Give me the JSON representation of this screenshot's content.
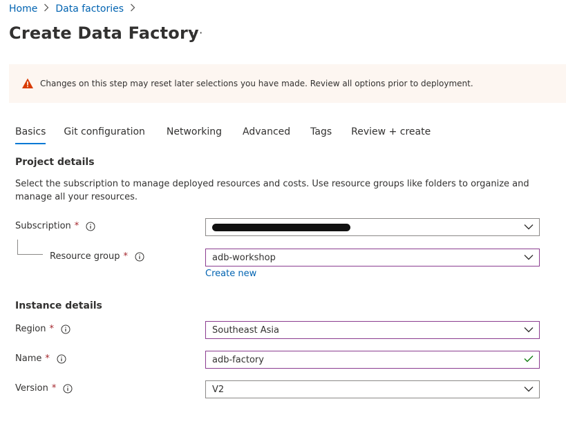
{
  "breadcrumb": [
    {
      "label": "Home"
    },
    {
      "label": "Data factories"
    }
  ],
  "page": {
    "title": "Create Data Factory",
    "more": "···"
  },
  "warning": {
    "text": "Changes on this step may reset later selections you have made. Review all options prior to deployment.",
    "icon": "warning-icon",
    "color": "#d83b01"
  },
  "tabs": [
    {
      "label": "Basics",
      "active": true
    },
    {
      "label": "Git configuration"
    },
    {
      "label": "Networking"
    },
    {
      "label": "Advanced"
    },
    {
      "label": "Tags"
    },
    {
      "label": "Review + create"
    }
  ],
  "project": {
    "title": "Project details",
    "description": "Select the subscription to manage deployed resources and costs. Use resource groups like folders to organize and manage all your resources.",
    "subscription": {
      "label": "Subscription",
      "required": "*",
      "value": ""
    },
    "resource_group": {
      "label": "Resource group",
      "required": "*",
      "value": "adb-workshop",
      "create_new": "Create new"
    }
  },
  "instance": {
    "title": "Instance details",
    "region": {
      "label": "Region",
      "required": "*",
      "value": "Southeast Asia"
    },
    "name": {
      "label": "Name",
      "required": "*",
      "value": "adb-factory"
    },
    "version": {
      "label": "Version",
      "required": "*",
      "value": "V2"
    }
  },
  "colors": {
    "accent": "#0078d4",
    "link": "#0063b1",
    "required": "#a4262c",
    "valid": "#107c10",
    "focused_border": "#8a3b8f"
  }
}
